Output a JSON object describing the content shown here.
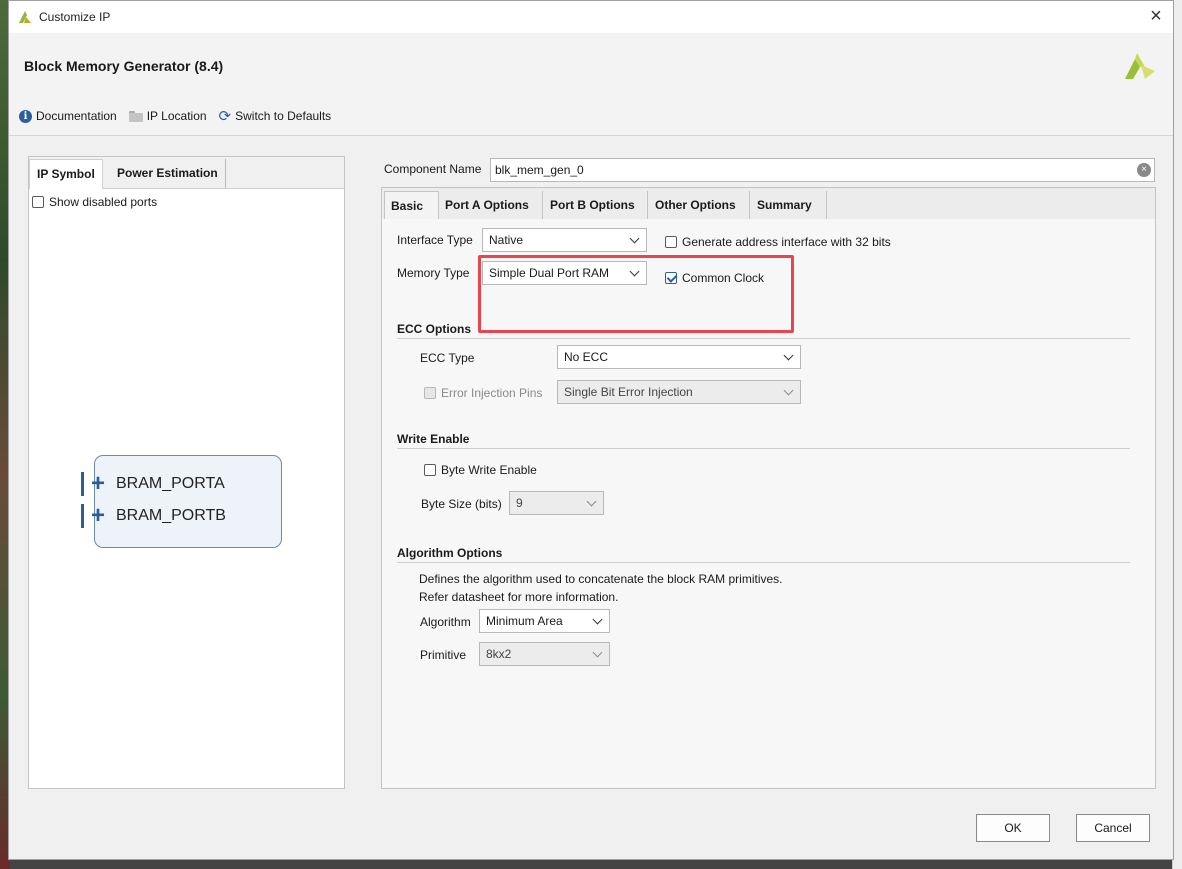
{
  "window": {
    "title": "Customize IP",
    "close_icon": "close-icon"
  },
  "header": {
    "ip_title": "Block Memory Generator (8.4)",
    "logo": "xilinx-logo",
    "toolbar": {
      "documentation": "Documentation",
      "ip_location": "IP Location",
      "switch_defaults": "Switch to Defaults"
    }
  },
  "left_panel": {
    "tabs": [
      "IP Symbol",
      "Power Estimation"
    ],
    "active_tab": "IP Symbol",
    "show_disabled_ports": {
      "label": "Show disabled ports",
      "checked": false
    },
    "symbol": {
      "ports": [
        "BRAM_PORTA",
        "BRAM_PORTB"
      ]
    }
  },
  "component": {
    "label": "Component Name",
    "value": "blk_mem_gen_0"
  },
  "right_panel": {
    "tabs": [
      "Basic",
      "Port A Options",
      "Port B Options",
      "Other Options",
      "Summary"
    ],
    "active_tab": "Basic",
    "basic": {
      "interface_type": {
        "label": "Interface Type",
        "value": "Native"
      },
      "memory_type": {
        "label": "Memory Type",
        "value": "Simple Dual Port RAM"
      },
      "gen_addr_32": {
        "label": "Generate address interface with 32 bits",
        "checked": false
      },
      "common_clock": {
        "label": "Common Clock",
        "checked": true
      }
    },
    "ecc": {
      "title": "ECC Options",
      "ecc_type": {
        "label": "ECC Type",
        "value": "No ECC"
      },
      "error_injection": {
        "label": "Error Injection Pins",
        "value": "Single Bit Error Injection",
        "enabled": false
      }
    },
    "write_enable": {
      "title": "Write Enable",
      "byte_write": {
        "label": "Byte Write Enable",
        "checked": false
      },
      "byte_size": {
        "label": "Byte Size (bits)",
        "value": "9",
        "enabled": false
      }
    },
    "algorithm": {
      "title": "Algorithm Options",
      "desc_line1": "Defines the algorithm used to concatenate the block RAM primitives.",
      "desc_line2": "Refer datasheet for more information.",
      "algorithm": {
        "label": "Algorithm",
        "value": "Minimum Area"
      },
      "primitive": {
        "label": "Primitive",
        "value": "8kx2",
        "enabled": false
      }
    }
  },
  "footer": {
    "ok": "OK",
    "cancel": "Cancel"
  },
  "colors": {
    "accent": "#2a5f9e",
    "highlight": "#e8464e",
    "symbol_border": "#6d88ad"
  }
}
